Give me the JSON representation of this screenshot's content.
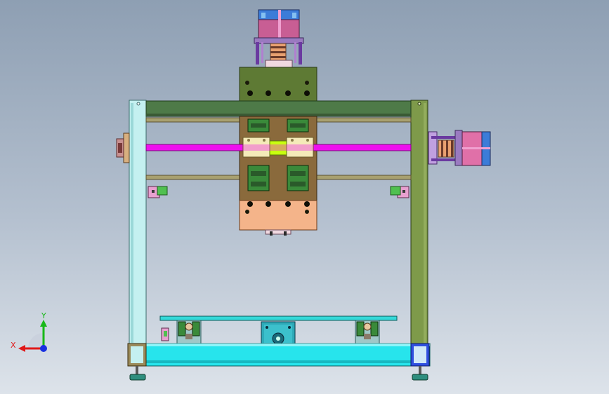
{
  "triad": {
    "x_label": "X",
    "y_label": "Y",
    "x_color": "#e01818",
    "y_color": "#18b818",
    "z_color": "#1830e0"
  },
  "colors": {
    "frame_left": "#b8ecec",
    "frame_right": "#7e9a4a",
    "top_beam": "#4e7a48",
    "base_beam": "#27e4ec",
    "bed": "#34d8d8",
    "carriage_top": "#5e7a34",
    "carriage_mid": "#8a6a3c",
    "carriage_bottom": "#f4b48a",
    "screw_rod": "#ee10ee",
    "guide_rod": "#a8a070",
    "bearing_block": "#3a8a3a",
    "coupler": "#f4eab8",
    "motor": "#e070a8",
    "motor_cap": "#3c7cd8"
  }
}
